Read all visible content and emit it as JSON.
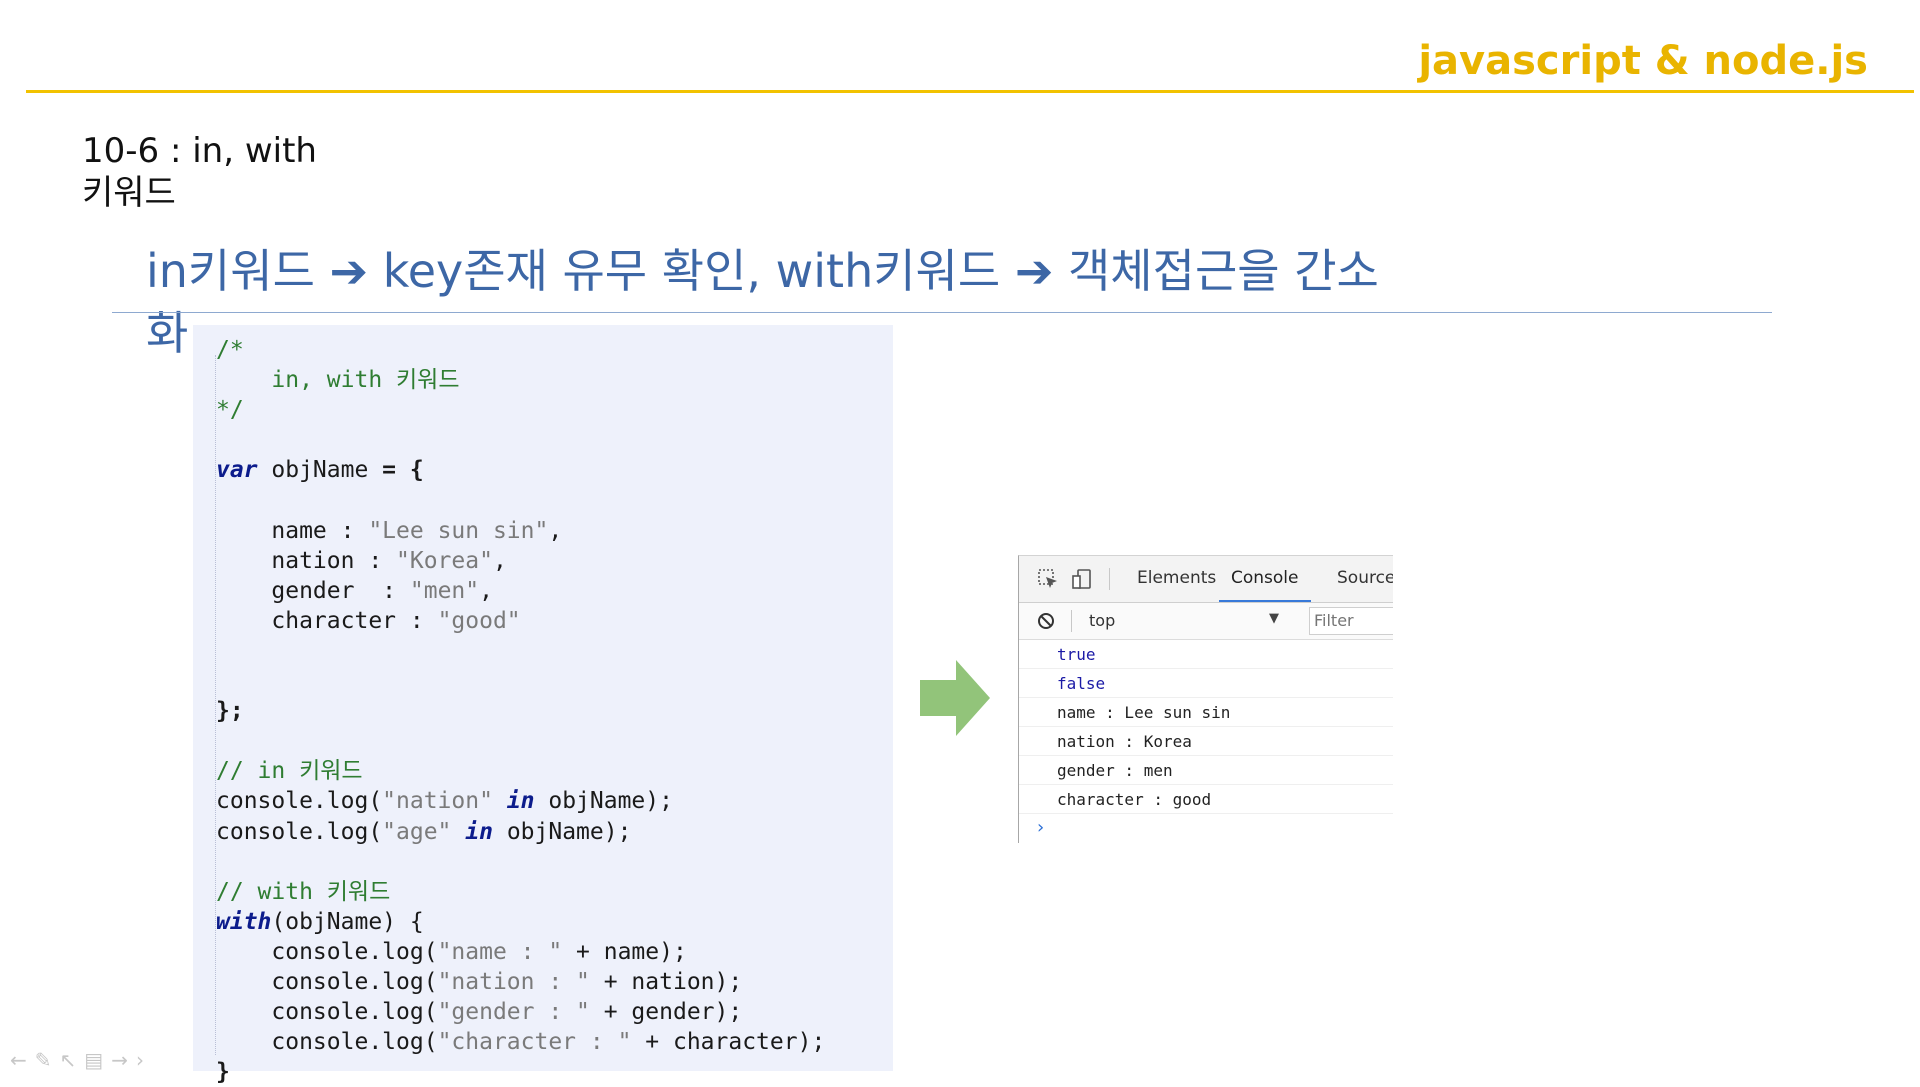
{
  "header": {
    "brand": "javascript & node.js",
    "slide_id_line1": "10-6 : in, with",
    "slide_id_line2": "키워드"
  },
  "headline": {
    "part1": "in키워드",
    "arrow": "➔",
    "part2": " key존재 유무 확인, with키워드 ",
    "part3": " 객체접근을 간소화"
  },
  "code": {
    "comment_open": "/*",
    "comment_body": "    in, with 키워드",
    "comment_close": "*/",
    "var_kw": "var",
    "var_name": " objName ",
    "assign": "= {",
    "props": [
      {
        "key": "    name : ",
        "value": "\"Lee sun sin\"",
        "tail": ","
      },
      {
        "key": "    nation : ",
        "value": "\"Korea\"",
        "tail": ","
      },
      {
        "key": "    gender  : ",
        "value": "\"men\"",
        "tail": ","
      },
      {
        "key": "    character : ",
        "value": "\"good\"",
        "tail": ""
      }
    ],
    "close_obj": "};",
    "in_comment": "// in 키워드",
    "in_lines": [
      {
        "pre": "console.log(",
        "str": "\"nation\"",
        "kw": " in",
        "post": " objName);"
      },
      {
        "pre": "console.log(",
        "str": "\"age\"",
        "kw": " in",
        "post": " objName);"
      }
    ],
    "with_comment": "// with 키워드",
    "with_kw": "with",
    "with_rest": "(objName) {",
    "with_lines": [
      {
        "pre": "    console.log(",
        "str": "\"name : \"",
        "post": " + name);"
      },
      {
        "pre": "    console.log(",
        "str": "\"nation : \"",
        "post": " + nation);"
      },
      {
        "pre": "    console.log(",
        "str": "\"gender : \"",
        "post": " + gender);"
      },
      {
        "pre": "    console.log(",
        "str": "\"character : \"",
        "post": " + character);"
      }
    ],
    "close_with": "}"
  },
  "devtools": {
    "tabs": [
      {
        "label": "Elements",
        "active": false
      },
      {
        "label": "Console",
        "active": true
      },
      {
        "label": "Sources",
        "active": false
      }
    ],
    "context": "top",
    "filter_placeholder": "Filter",
    "output": [
      {
        "text": "true",
        "kind": "bool"
      },
      {
        "text": "false",
        "kind": "bool"
      },
      {
        "text": "name : Lee sun sin",
        "kind": "text"
      },
      {
        "text": "nation : Korea",
        "kind": "text"
      },
      {
        "text": "gender : men",
        "kind": "text"
      },
      {
        "text": "character : good",
        "kind": "text"
      }
    ],
    "prompt": "›"
  },
  "colors": {
    "brand": "#e9b400",
    "headline": "#3d67a6",
    "arrow_fill": "#92c47a",
    "code_bg": "#eef1fb"
  },
  "icons": {
    "arrow": "right-arrow-icon",
    "inspect": "inspect-icon",
    "device": "device-toggle-icon",
    "clear": "clear-console-icon",
    "caret": "dropdown-caret-icon"
  }
}
